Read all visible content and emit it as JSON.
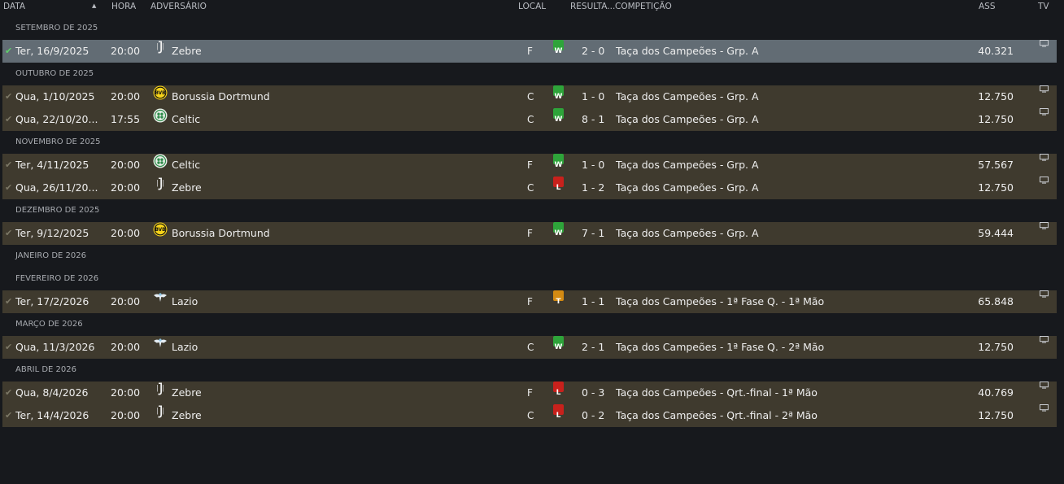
{
  "header": {
    "date": "DATA",
    "time": "HORA",
    "opponent": "ADVERSÁRIO",
    "venue": "LOCAL",
    "result": "RESULTA...",
    "competition": "COMPETIÇÃO",
    "attendance": "ASS",
    "tv": "TV"
  },
  "colors": {
    "win": "#2ea43a",
    "loss": "#c8211c",
    "draw": "#d38a12",
    "row": "#3f3a2e",
    "row_selected": "#626c74",
    "background": "#17191d"
  },
  "groups": [
    {
      "label": "SETEMBRO DE 2025",
      "matches": [
        {
          "date": "Ter, 16/9/2025",
          "time": "20:00",
          "crest": "juventus-crest",
          "opponent": "Zebre",
          "venue": "F",
          "result": "W",
          "score": "2 - 0",
          "competition": "Taça dos Campeões - Grp. A",
          "attendance": "40.321",
          "selected": true
        }
      ]
    },
    {
      "label": "OUTUBRO DE 2025",
      "matches": [
        {
          "date": "Qua, 1/10/2025",
          "time": "20:00",
          "crest": "dortmund-crest",
          "opponent": "Borussia Dortmund",
          "venue": "C",
          "result": "W",
          "score": "1 - 0",
          "competition": "Taça dos Campeões - Grp. A",
          "attendance": "12.750"
        },
        {
          "date": "Qua, 22/10/20...",
          "time": "17:55",
          "crest": "celtic-crest",
          "opponent": "Celtic",
          "venue": "C",
          "result": "W",
          "score": "8 - 1",
          "competition": "Taça dos Campeões - Grp. A",
          "attendance": "12.750"
        }
      ]
    },
    {
      "label": "NOVEMBRO DE 2025",
      "matches": [
        {
          "date": "Ter, 4/11/2025",
          "time": "20:00",
          "crest": "celtic-crest",
          "opponent": "Celtic",
          "venue": "F",
          "result": "W",
          "score": "1 - 0",
          "competition": "Taça dos Campeões - Grp. A",
          "attendance": "57.567"
        },
        {
          "date": "Qua, 26/11/20...",
          "time": "20:00",
          "crest": "juventus-crest",
          "opponent": "Zebre",
          "venue": "C",
          "result": "L",
          "score": "1 - 2",
          "competition": "Taça dos Campeões - Grp. A",
          "attendance": "12.750"
        }
      ]
    },
    {
      "label": "DEZEMBRO DE 2025",
      "matches": [
        {
          "date": "Ter, 9/12/2025",
          "time": "20:00",
          "crest": "dortmund-crest",
          "opponent": "Borussia Dortmund",
          "venue": "F",
          "result": "W",
          "score": "7 - 1",
          "competition": "Taça dos Campeões - Grp. A",
          "attendance": "59.444"
        }
      ]
    },
    {
      "label": "JANEIRO DE 2026",
      "matches": []
    },
    {
      "label": "FEVEREIRO DE 2026",
      "matches": [
        {
          "date": "Ter, 17/2/2026",
          "time": "20:00",
          "crest": "lazio-crest",
          "opponent": "Lazio",
          "venue": "F",
          "result": "T",
          "score": "1 - 1",
          "competition": "Taça dos Campeões - 1ª Fase Q. - 1ª Mão",
          "attendance": "65.848"
        }
      ]
    },
    {
      "label": "MARÇO DE 2026",
      "matches": [
        {
          "date": "Qua, 11/3/2026",
          "time": "20:00",
          "crest": "lazio-crest",
          "opponent": "Lazio",
          "venue": "C",
          "result": "W",
          "score": "2 - 1",
          "competition": "Taça dos Campeões - 1ª Fase Q. - 2ª Mão",
          "attendance": "12.750"
        }
      ]
    },
    {
      "label": "ABRIL DE 2026",
      "matches": [
        {
          "date": "Qua, 8/4/2026",
          "time": "20:00",
          "crest": "juventus-crest",
          "opponent": "Zebre",
          "venue": "F",
          "result": "L",
          "score": "0 - 3",
          "competition": "Taça dos Campeões - Qrt.-final - 1ª Mão",
          "attendance": "40.769"
        },
        {
          "date": "Ter, 14/4/2026",
          "time": "20:00",
          "crest": "juventus-crest",
          "opponent": "Zebre",
          "venue": "C",
          "result": "L",
          "score": "0 - 2",
          "competition": "Taça dos Campeões - Qrt.-final - 2ª Mão",
          "attendance": "12.750"
        }
      ]
    }
  ]
}
